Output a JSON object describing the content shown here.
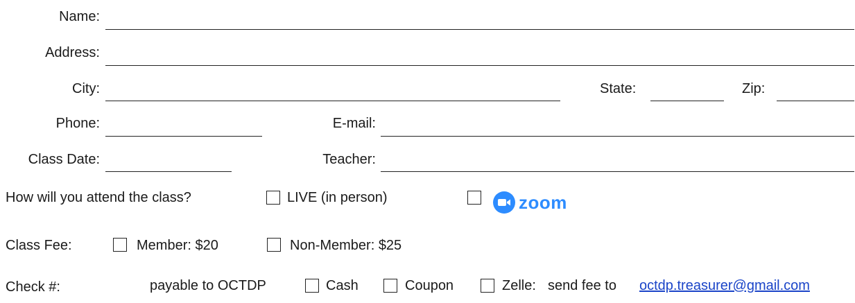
{
  "fields": {
    "name": "Name:",
    "address": "Address:",
    "city": "City:",
    "state": "State:",
    "zip": "Zip:",
    "phone": "Phone:",
    "email": "E-mail:",
    "class_date": "Class Date:",
    "teacher": "Teacher:"
  },
  "attend": {
    "question": "How will you attend the class?",
    "live_label": "LIVE (in person)",
    "zoom_label": "zoom"
  },
  "fee": {
    "label": "Class Fee:",
    "member": "Member: $20",
    "non_member": "Non-Member: $25"
  },
  "payment": {
    "check_label": "Check #:",
    "payable": "payable to OCTDP",
    "cash": "Cash",
    "coupon": "Coupon",
    "zelle": "Zelle:",
    "send_fee": "send fee to",
    "email_link": "octdp.treasurer@gmail.com"
  },
  "colors": {
    "zoom_blue": "#2d8cff",
    "link_blue": "#1a44c8"
  }
}
